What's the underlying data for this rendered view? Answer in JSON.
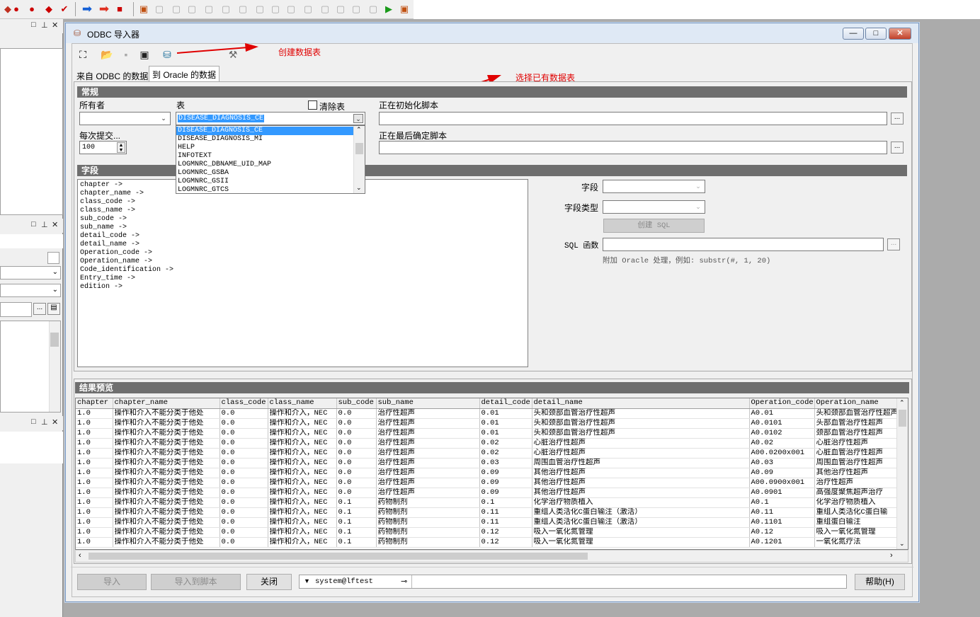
{
  "window": {
    "title": "ODBC 导入器",
    "min": "—",
    "max": "□",
    "close": "✕"
  },
  "tabs": [
    {
      "label": "来自 ODBC 的数据"
    },
    {
      "label": "到 Oracle 的数据"
    }
  ],
  "annotations": {
    "create_table": "创建数据表",
    "select_table": "选择已有数据表"
  },
  "general": {
    "title": "常规",
    "owner_label": "所有者",
    "table_label": "表",
    "table_value": "DISEASE_DIAGNOSIS_CE",
    "truncate_label": "清除表",
    "commit_label": "每次提交...",
    "commit_value": "100",
    "init_script_label": "正在初始化脚本",
    "final_script_label": "正在最后确定脚本",
    "dots": "..."
  },
  "table_options": [
    "DISEASE_DIAGNOSIS_CE",
    "DISEASE_DIAGNOSIS_MI",
    "HELP",
    "INFOTEXT",
    "LOGMNRC_DBNAME_UID_MAP",
    "LOGMNRC_GSBA",
    "LOGMNRC_GSII",
    "LOGMNRC_GTCS"
  ],
  "fields": {
    "title": "字段",
    "items": [
      "chapter  ->",
      "chapter_name  ->",
      "class_code  ->",
      "class_name  ->",
      "sub_code  ->",
      "sub_name  ->",
      "detail_code  ->",
      "detail_name  ->",
      "Operation_code  ->",
      "Operation_name  ->",
      "Code_identification  ->",
      "Entry_time  ->",
      "edition  ->"
    ],
    "field_label": "字段",
    "field_type_label": "字段类型",
    "create_sql": "创建 SQL",
    "sql_func_label": "SQL 函数",
    "hint": "附加 Oracle 处理，例如:  substr(#, 1, 20)"
  },
  "preview": {
    "title": "结果预览",
    "columns": [
      "chapter",
      "chapter_name",
      "class_code",
      "class_name",
      "sub_code",
      "sub_name",
      "detail_code",
      "detail_name",
      "Operation_code",
      "Operation_name"
    ],
    "rows": [
      [
        "1.0",
        "操作和介入不能分类于他处",
        "0.0",
        "操作和介入，NEC",
        "0.0",
        "治疗性超声",
        "0.01",
        "头和颈部血管治疗性超声",
        "A0.01",
        "头和颈部血管治疗性超声"
      ],
      [
        "1.0",
        "操作和介入不能分类于他处",
        "0.0",
        "操作和介入，NEC",
        "0.0",
        "治疗性超声",
        "0.01",
        "头和颈部血管治疗性超声",
        "A0.0101",
        "头部血管治疗性超声"
      ],
      [
        "1.0",
        "操作和介入不能分类于他处",
        "0.0",
        "操作和介入，NEC",
        "0.0",
        "治疗性超声",
        "0.01",
        "头和颈部血管治疗性超声",
        "A0.0102",
        "颈部血管治疗性超声"
      ],
      [
        "1.0",
        "操作和介入不能分类于他处",
        "0.0",
        "操作和介入，NEC",
        "0.0",
        "治疗性超声",
        "0.02",
        "心脏治疗性超声",
        "A0.02",
        "心脏治疗性超声"
      ],
      [
        "1.0",
        "操作和介入不能分类于他处",
        "0.0",
        "操作和介入，NEC",
        "0.0",
        "治疗性超声",
        "0.02",
        "心脏治疗性超声",
        "A00.0200x001",
        "心脏血管治疗性超声"
      ],
      [
        "1.0",
        "操作和介入不能分类于他处",
        "0.0",
        "操作和介入，NEC",
        "0.0",
        "治疗性超声",
        "0.03",
        "周围血管治疗性超声",
        "A0.03",
        "周围血管治疗性超声"
      ],
      [
        "1.0",
        "操作和介入不能分类于他处",
        "0.0",
        "操作和介入，NEC",
        "0.0",
        "治疗性超声",
        "0.09",
        "其他治疗性超声",
        "A0.09",
        "其他治疗性超声"
      ],
      [
        "1.0",
        "操作和介入不能分类于他处",
        "0.0",
        "操作和介入，NEC",
        "0.0",
        "治疗性超声",
        "0.09",
        "其他治疗性超声",
        "A00.0900x001",
        "治疗性超声"
      ],
      [
        "1.0",
        "操作和介入不能分类于他处",
        "0.0",
        "操作和介入，NEC",
        "0.0",
        "治疗性超声",
        "0.09",
        "其他治疗性超声",
        "A0.0901",
        "高强度聚焦超声治疗"
      ],
      [
        "1.0",
        "操作和介入不能分类于他处",
        "0.0",
        "操作和介入，NEC",
        "0.1",
        "药物制剂",
        "0.1",
        "化学治疗物质植入",
        "A0.1",
        "化学治疗物质植入"
      ],
      [
        "1.0",
        "操作和介入不能分类于他处",
        "0.0",
        "操作和介入，NEC",
        "0.1",
        "药物制剂",
        "0.11",
        "重组人类活化C蛋白输注（激活）",
        "A0.11",
        "重组人类活化C蛋白输"
      ],
      [
        "1.0",
        "操作和介入不能分类于他处",
        "0.0",
        "操作和介入，NEC",
        "0.1",
        "药物制剂",
        "0.11",
        "重组人类活化C蛋白输注（激活）",
        "A0.1101",
        "重组蛋白输注"
      ],
      [
        "1.0",
        "操作和介入不能分类于他处",
        "0.0",
        "操作和介入，NEC",
        "0.1",
        "药物制剂",
        "0.12",
        "吸入一氧化氮管理",
        "A0.12",
        "吸入一氧化氮管理"
      ],
      [
        "1.0",
        "操作和介入不能分类于他处",
        "0.0",
        "操作和介入，NEC",
        "0.1",
        "药物制剂",
        "0.12",
        "吸入一氧化氮管理",
        "A0.1201",
        "一氧化氮疗法"
      ]
    ]
  },
  "bottom": {
    "import": "导入",
    "import_to_script": "导入到脚本",
    "close": "关闭",
    "connection": "system@lftest",
    "help": "帮助(H)"
  }
}
